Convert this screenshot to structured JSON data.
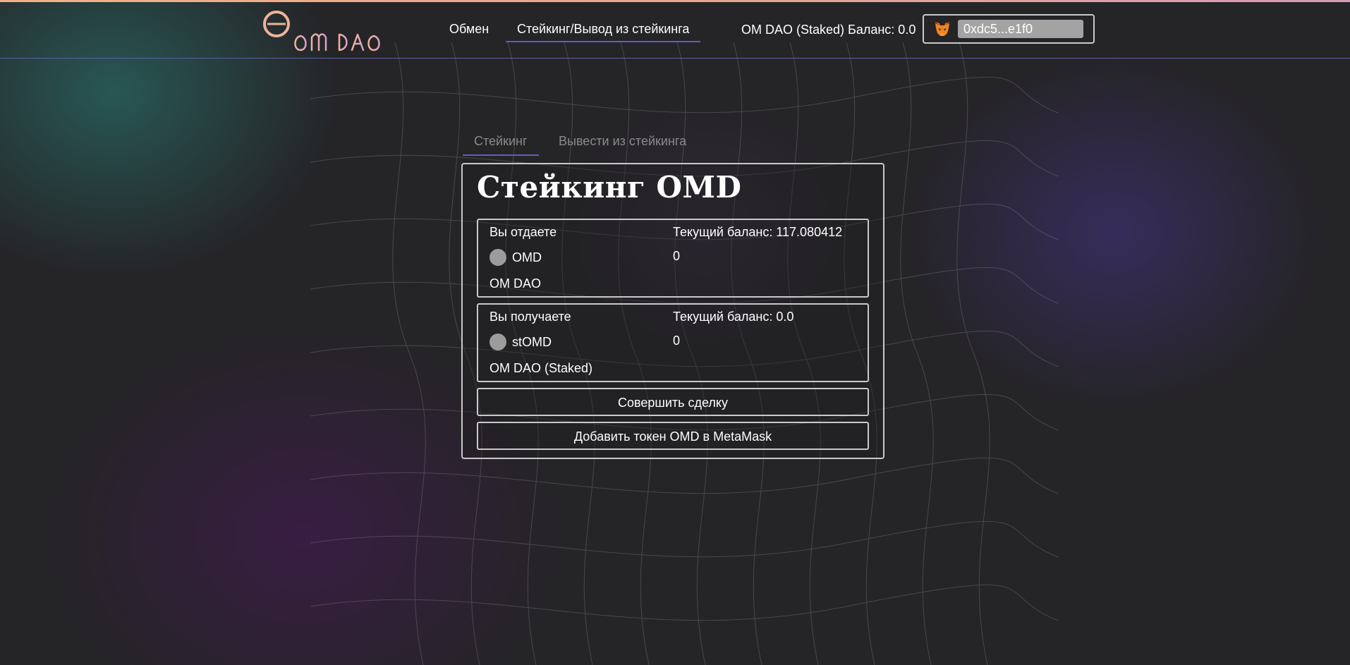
{
  "header": {
    "nav": {
      "exchange_label": "Обмен",
      "staking_label": "Стейкинг/Вывод из стейкинга"
    },
    "balance_text": "OM DAO (Staked) Баланс: 0.0",
    "wallet": {
      "icon": "metamask-fox-icon",
      "address": "0xdc5...e1f0"
    }
  },
  "tabs": {
    "stake_label": "Стейкинг",
    "unstake_label": "Вывести из стейкинга",
    "active": "stake"
  },
  "card": {
    "title": "Стейкинг OMD",
    "give": {
      "label": "Вы отдаете",
      "balance_text": "Текущий баланс: 117.080412",
      "symbol": "OMD",
      "amount": "0",
      "token_name": "OM DAO"
    },
    "get": {
      "label": "Вы получаете",
      "balance_text": "Текущий баланс: 0.0",
      "symbol": "stOMD",
      "amount": "0",
      "token_name": "OM DAO (Staked)"
    },
    "trade_button": "Совершить сделку",
    "add_token_button": "Добавить токен OMD в MetaMask"
  },
  "colors": {
    "accent": "#5b5fc0",
    "logo_peach": "#eeb39a",
    "logo_pink": "#d9a3c6",
    "border": "#c9c9c9",
    "background": "#242424"
  }
}
